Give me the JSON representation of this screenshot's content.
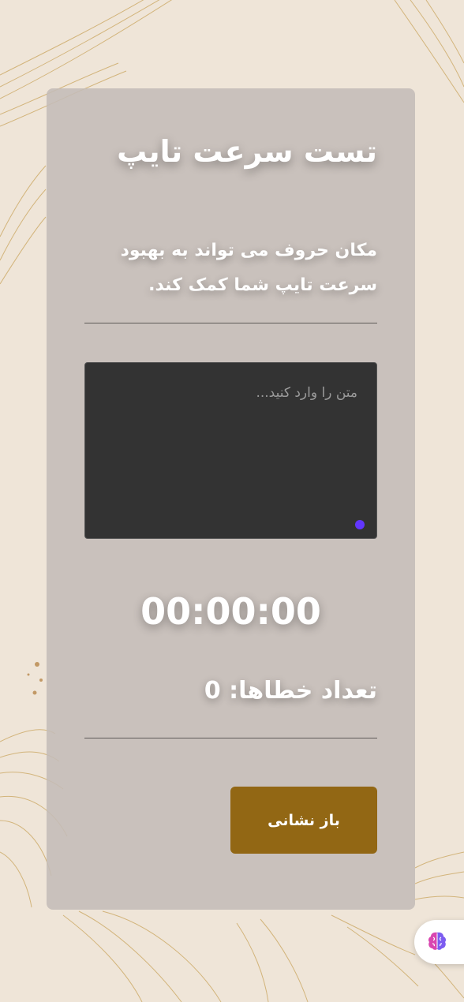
{
  "app": {
    "title": "تست سرعت تایپ",
    "subtitle": "مکان حروف می تواند به بهبود سرعت تایپ شما کمک کند."
  },
  "typing": {
    "placeholder": "متن را وارد کنید..."
  },
  "timer": {
    "value": "00:00:00"
  },
  "errors": {
    "text": "تعداد خطاها: 0"
  },
  "actions": {
    "reset_label": "باز نشانی"
  },
  "fab": {
    "icon": "brain-icon"
  },
  "colors": {
    "accent_button": "#926714",
    "resize_dot": "#6236ff",
    "textarea_bg": "#333333"
  }
}
